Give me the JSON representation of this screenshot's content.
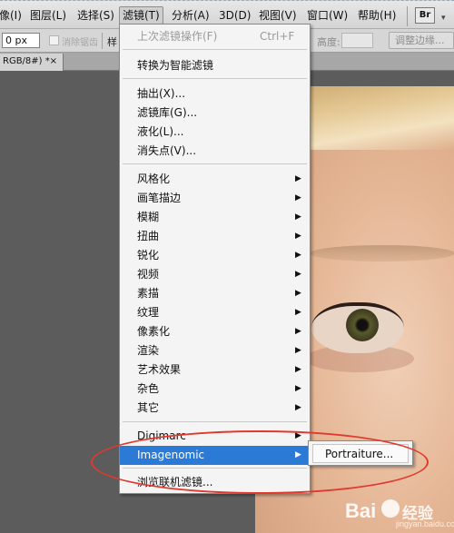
{
  "menubar": {
    "items": [
      {
        "label": "像(I)"
      },
      {
        "label": "图层(L)"
      },
      {
        "label": "选择(S)"
      },
      {
        "label": "滤镜(T)"
      },
      {
        "label": "分析(A)"
      },
      {
        "label": "3D(D)"
      },
      {
        "label": "视图(V)"
      },
      {
        "label": "窗口(W)"
      },
      {
        "label": "帮助(H)"
      }
    ],
    "bridge_label": "Br"
  },
  "options": {
    "feather_value": "0 px",
    "antialias_label": "消除锯齿",
    "style_label": "样",
    "height_label": "高度:",
    "refine_edge_label": "调整边缘..."
  },
  "document": {
    "tab_label": "RGB/8#) *",
    "close_glyph": "×"
  },
  "filter_menu": {
    "last_filter": {
      "label": "上次滤镜操作(F)",
      "shortcut": "Ctrl+F"
    },
    "smart_filter": "转换为智能滤镜",
    "group1": [
      "抽出(X)...",
      "滤镜库(G)...",
      "液化(L)...",
      "消失点(V)..."
    ],
    "submenus": [
      "风格化",
      "画笔描边",
      "模糊",
      "扭曲",
      "锐化",
      "视频",
      "素描",
      "纹理",
      "像素化",
      "渲染",
      "艺术效果",
      "杂色",
      "其它"
    ],
    "plugins": [
      "Digimarc",
      "Imagenomic"
    ],
    "browse_online": "浏览联机滤镜...",
    "arrow_glyph": "▶"
  },
  "imagenomic_submenu": {
    "items": [
      "Portraiture..."
    ]
  },
  "colors": {
    "highlight": "#2a7ad6",
    "annotation": "#e0392f"
  },
  "watermark": {
    "brand": "Bai",
    "brand_cn": "经验",
    "url": "jingyan.baidu.com"
  }
}
